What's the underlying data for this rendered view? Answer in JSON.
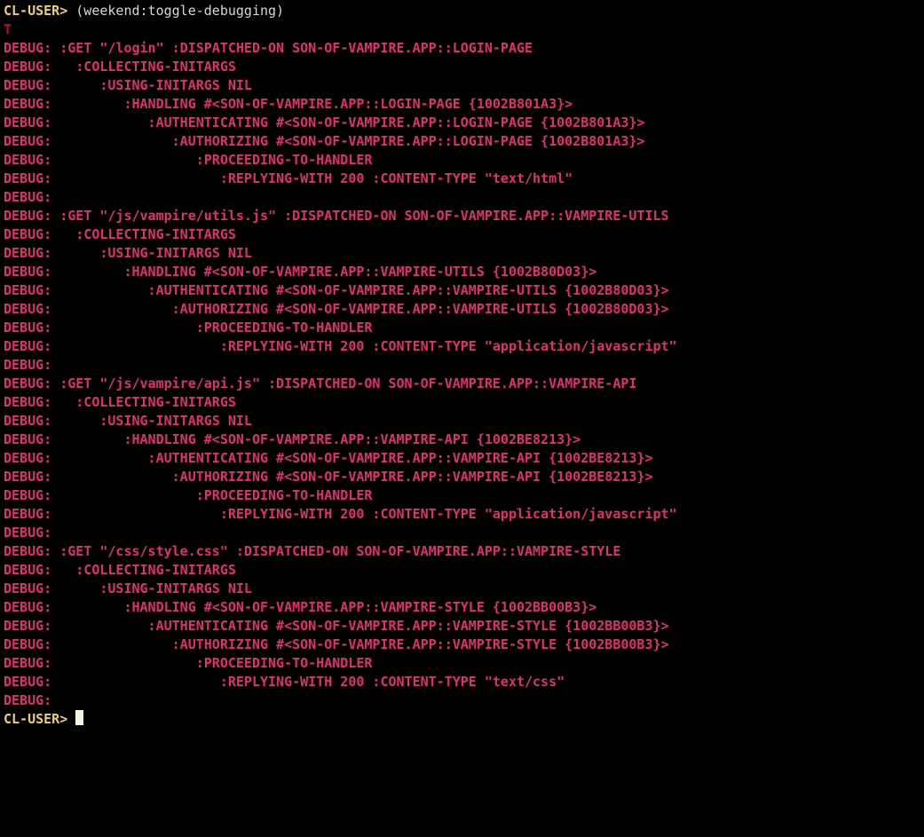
{
  "prompt": "CL-USER>",
  "command": "(weekend:toggle-debugging)",
  "result": "T",
  "debugPrefix": "DEBUG:",
  "requests": [
    {
      "method": ":GET",
      "path": "\"/login\"",
      "dispatchedOn": "SON-OF-VAMPIRE.APP::LOGIN-PAGE",
      "className": "SON-OF-VAMPIRE.APP::LOGIN-PAGE",
      "objId": "{1002B801A3}",
      "status": 200,
      "contentType": "\"text/html\""
    },
    {
      "method": ":GET",
      "path": "\"/js/vampire/utils.js\"",
      "dispatchedOn": "SON-OF-VAMPIRE.APP::VAMPIRE-UTILS",
      "className": "SON-OF-VAMPIRE.APP::VAMPIRE-UTILS",
      "objId": "{1002B80D03}",
      "status": 200,
      "contentType": "\"application/javascript\""
    },
    {
      "method": ":GET",
      "path": "\"/js/vampire/api.js\"",
      "dispatchedOn": "SON-OF-VAMPIRE.APP::VAMPIRE-API",
      "className": "SON-OF-VAMPIRE.APP::VAMPIRE-API",
      "objId": "{1002BE8213}",
      "status": 200,
      "contentType": "\"application/javascript\""
    },
    {
      "method": ":GET",
      "path": "\"/css/style.css\"",
      "dispatchedOn": "SON-OF-VAMPIRE.APP::VAMPIRE-STYLE",
      "className": "SON-OF-VAMPIRE.APP::VAMPIRE-STYLE",
      "objId": "{1002BB00B3}",
      "status": 200,
      "contentType": "\"text/css\""
    }
  ],
  "labels": {
    "dispatchedOn": ":DISPATCHED-ON",
    "collecting": ":COLLECTING-INITARGS",
    "using": ":USING-INITARGS NIL",
    "handling": ":HANDLING",
    "authenticating": ":AUTHENTICATING",
    "authorizing": ":AUTHORIZING",
    "proceeding": ":PROCEEDING-TO-HANDLER",
    "replying": ":REPLYING-WITH",
    "contentType": ":CONTENT-TYPE"
  }
}
